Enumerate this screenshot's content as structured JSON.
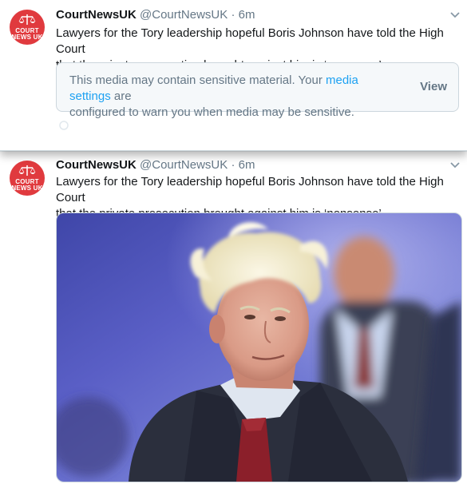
{
  "tweets": [
    {
      "name": "CourtNewsUK",
      "handle": "@CourtNewsUK",
      "separator": "·",
      "time": "6m",
      "avatar_top": "COURT",
      "avatar_bottom": "NEWS UK",
      "text_line1": "Lawyers for the Tory leadership hopeful Boris Johnson have told the High Court",
      "text_line2": "that the private prosecution brought against him is ‘nonsense’.",
      "sensitive": {
        "line1_prefix": "This media may contain sensitive material. Your ",
        "link": "media settings",
        "line1_suffix": " are",
        "line2": "configured to warn you when media may be sensitive.",
        "view_label": "View"
      }
    },
    {
      "name": "CourtNewsUK",
      "handle": "@CourtNewsUK",
      "separator": "·",
      "time": "6m",
      "avatar_top": "COURT",
      "avatar_bottom": "NEWS UK",
      "text_line1": "Lawyers for the Tory leadership hopeful Boris Johnson have told the High Court",
      "text_line2": "that the private prosecution brought against him is ‘nonsense’.",
      "media_icon": "photo-of-man-in-suit"
    }
  ],
  "colors": {
    "brand_red": "#e03a3e",
    "link_blue": "#1da1f2",
    "muted_gray": "#657786"
  }
}
